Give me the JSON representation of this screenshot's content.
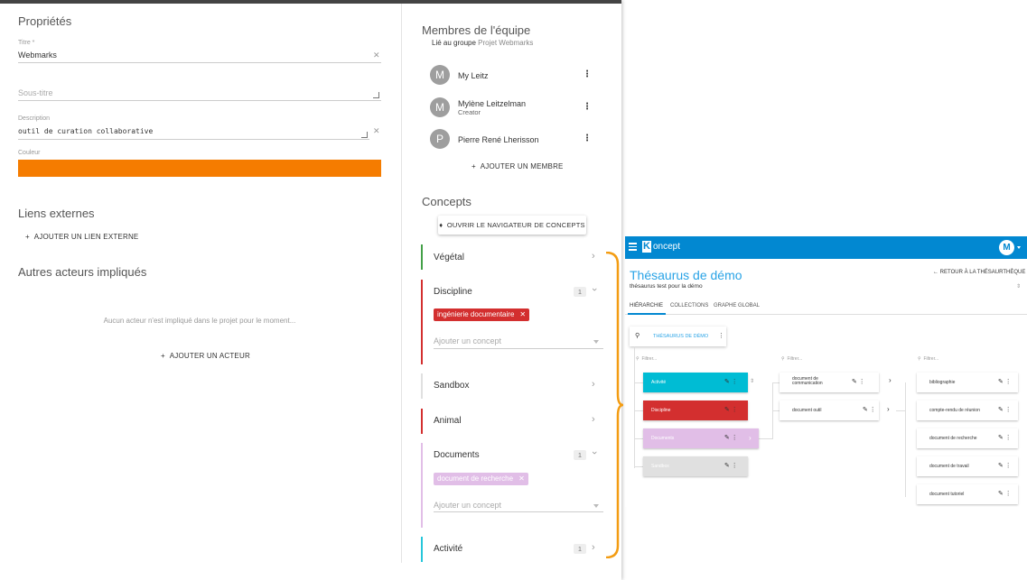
{
  "left": {
    "properties_title": "Propriétés",
    "title_label": "Titre *",
    "title_value": "Webmarks",
    "subtitle_placeholder": "Sous-titre",
    "description_label": "Description",
    "description_value": "outil de curation collaborative",
    "color_label": "Couleur",
    "color_value": "#f57c00",
    "external_links_title": "Liens externes",
    "add_external_link": "AJOUTER UN LIEN EXTERNE",
    "other_actors_title": "Autres acteurs impliqués",
    "no_actor_text": "Aucun acteur n'est impliqué dans le projet pour le moment...",
    "add_actor": "AJOUTER UN ACTEUR"
  },
  "team": {
    "title": "Membres de l'équipe",
    "linked_prefix": "Lié au groupe",
    "linked_group": "Projet Webmarks",
    "members": [
      {
        "initial": "M",
        "name": "My Leitz",
        "role": ""
      },
      {
        "initial": "M",
        "name": "Mylène Leitzelman",
        "role": "Creator"
      },
      {
        "initial": "P",
        "name": "Pierre René Lherisson",
        "role": ""
      }
    ],
    "add_member": "AJOUTER UN MEMBRE"
  },
  "concepts": {
    "title": "Concepts",
    "open_navigator": "OUVRIR LE NAVIGATEUR DE CONCEPTS",
    "add_placeholder": "Ajouter un concept",
    "groups": [
      {
        "name": "Végétal",
        "color": "#43a047",
        "count": "",
        "chips": []
      },
      {
        "name": "Discipline",
        "color": "#d32f2f",
        "count": "1",
        "chips": [
          "ingénierie documentaire"
        ]
      },
      {
        "name": "Sandbox",
        "color": "#e0e0e0",
        "count": "",
        "chips": []
      },
      {
        "name": "Animal",
        "color": "#d32f2f",
        "count": "",
        "chips": []
      },
      {
        "name": "Documents",
        "color": "#e1bee7",
        "count": "1",
        "chips": [
          "document de recherche"
        ]
      },
      {
        "name": "Activité",
        "color": "#26c6da",
        "count": "1",
        "chips": []
      }
    ]
  },
  "koncept": {
    "brand": "oncept",
    "brand_letter": "K",
    "user_initial": "M",
    "title": "Thésaurus de démo",
    "subtitle": "thésaurus test pour la démo",
    "back": "RETOUR À LA THÉSAURTHÈQUE",
    "tabs": [
      "HIÉRARCHIE",
      "COLLECTIONS",
      "GRAPHE GLOBAL"
    ],
    "thesaurus_label": "THÉSAURUS DE DÉMO",
    "search_label": "Filtrer...",
    "col1": [
      {
        "label": "Activité",
        "color": "#00bcd4"
      },
      {
        "label": "Discipline",
        "color": "#d32f2f"
      },
      {
        "label": "Documents",
        "color": "#e1bee7"
      },
      {
        "label": "Sandbox",
        "color": "#e0e0e0"
      }
    ],
    "col2": [
      "document de communication",
      "document outil"
    ],
    "col3": [
      "bibliographie",
      "compte-rendu de réunion",
      "document de recherche",
      "document de travail",
      "document tutoriel"
    ]
  }
}
